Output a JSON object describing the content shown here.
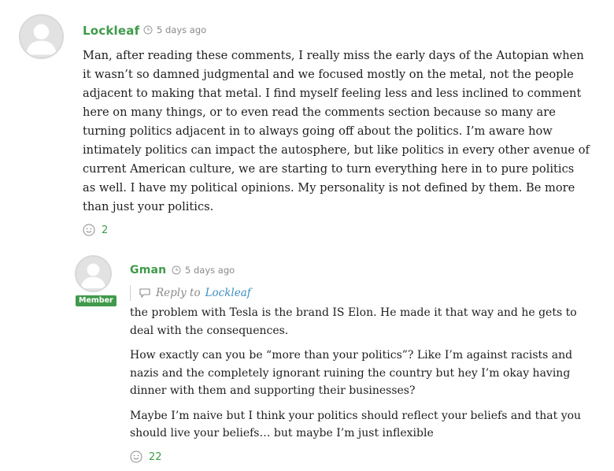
{
  "comments": [
    {
      "author": "Lockleaf",
      "time": "5 days ago",
      "paragraphs": [
        "Man, after reading these comments, I really miss the early days of the Autopian when it wasn’t so damned judgmental and we focused mostly on the metal, not the people adjacent to making that metal. I find myself feeling less and less inclined to comment here on many things, or to even read the comments section because so many are turning politics adjacent in to always going off about the politics. I’m aware how intimately politics can impact the autosphere, but like politics in every other avenue of current American culture, we are starting to turn everything here in to pure politics as well. I have my political opinions. My personality is not defined by them. Be more than just your politics."
      ],
      "reactions": "2"
    },
    {
      "author": "Gman",
      "badge": "Member",
      "time": "5 days ago",
      "reply_label": "Reply to",
      "reply_target": "Lockleaf",
      "paragraphs": [
        "the problem with Tesla is the brand IS Elon. He made it that way and he gets to deal with the consequences.",
        "How exactly can you be “more than your politics”? Like I’m against racists and nazis and the completely ignorant ruining the country but hey I’m okay having dinner with them and supporting their businesses?",
        "Maybe I’m naive but I think your politics should reflect your beliefs and that you should live your beliefs… but maybe I’m just inflexible"
      ],
      "reactions": "22"
    }
  ]
}
